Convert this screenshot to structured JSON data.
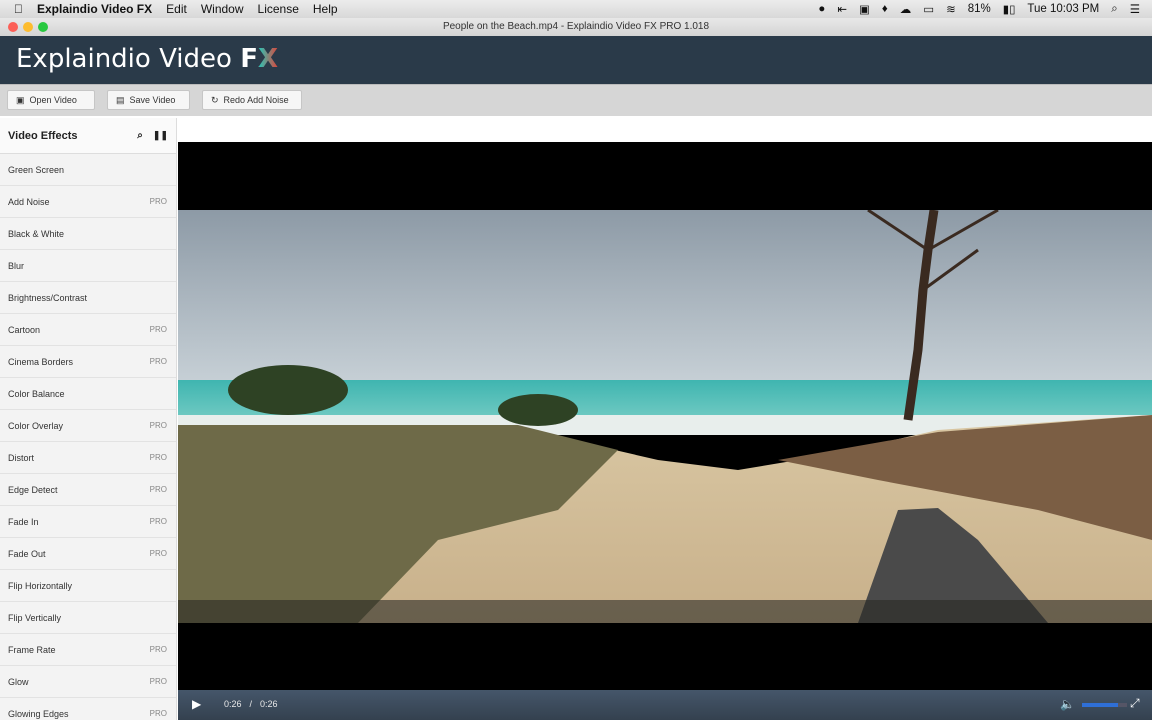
{
  "menubar": {
    "app": "Explaindio Video FX",
    "items": [
      "Edit",
      "Window",
      "License",
      "Help"
    ],
    "battery": "81%",
    "clock": "Tue 10:03 PM"
  },
  "window": {
    "title": "People on the Beach.mp4 - Explaindio Video FX PRO 1.018"
  },
  "header": {
    "logo_text": "Explaindio Video",
    "logo_fx": "FX"
  },
  "toolbar": {
    "open": "Open Video",
    "save": "Save Video",
    "redo": "Redo Add Noise"
  },
  "sidebar": {
    "title": "Video Effects",
    "items": [
      {
        "label": "Green Screen",
        "badge": ""
      },
      {
        "label": "Add Noise",
        "badge": "PRO"
      },
      {
        "label": "Black & White",
        "badge": ""
      },
      {
        "label": "Blur",
        "badge": ""
      },
      {
        "label": "Brightness/Contrast",
        "badge": ""
      },
      {
        "label": "Cartoon",
        "badge": "PRO"
      },
      {
        "label": "Cinema Borders",
        "badge": "PRO"
      },
      {
        "label": "Color Balance",
        "badge": ""
      },
      {
        "label": "Color Overlay",
        "badge": "PRO"
      },
      {
        "label": "Distort",
        "badge": "PRO"
      },
      {
        "label": "Edge Detect",
        "badge": "PRO"
      },
      {
        "label": "Fade In",
        "badge": "PRO"
      },
      {
        "label": "Fade Out",
        "badge": "PRO"
      },
      {
        "label": "Flip Horizontally",
        "badge": ""
      },
      {
        "label": "Flip Vertically",
        "badge": ""
      },
      {
        "label": "Frame Rate",
        "badge": "PRO"
      },
      {
        "label": "Glow",
        "badge": "PRO"
      },
      {
        "label": "Glowing Edges",
        "badge": "PRO"
      }
    ]
  },
  "player": {
    "current": "0:26",
    "separator": "/",
    "duration": "0:26",
    "volume": 0.8
  }
}
